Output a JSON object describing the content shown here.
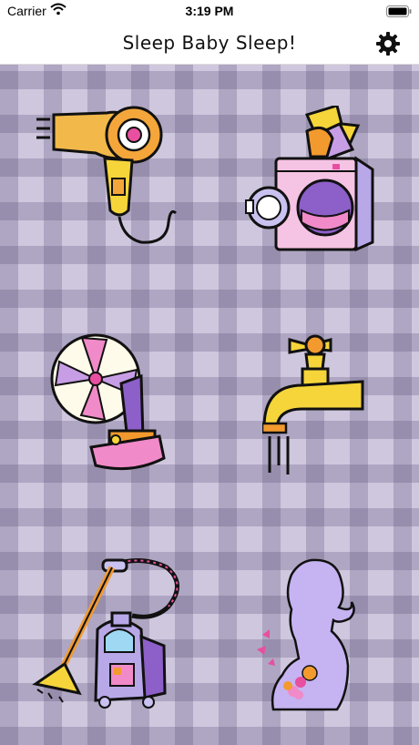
{
  "status_bar": {
    "carrier": "Carrier",
    "time": "3:19 PM"
  },
  "nav": {
    "title": "Sleep Baby Sleep!",
    "settings_icon": "gear-icon"
  },
  "sounds": [
    {
      "name": "hair-dryer",
      "icon": "hair-dryer-icon"
    },
    {
      "name": "washing-machine",
      "icon": "washing-machine-icon"
    },
    {
      "name": "fan",
      "icon": "fan-icon"
    },
    {
      "name": "faucet",
      "icon": "faucet-icon"
    },
    {
      "name": "vacuum-cleaner",
      "icon": "vacuum-cleaner-icon"
    },
    {
      "name": "womb",
      "icon": "pregnant-silhouette-icon"
    }
  ],
  "colors": {
    "background": "#cfc7de",
    "plaid_stripe": "#8a7fa8",
    "yellow": "#f5d53a",
    "pink": "#f08ac8",
    "lavender": "#b8a8e8",
    "orange": "#f29a2e"
  }
}
